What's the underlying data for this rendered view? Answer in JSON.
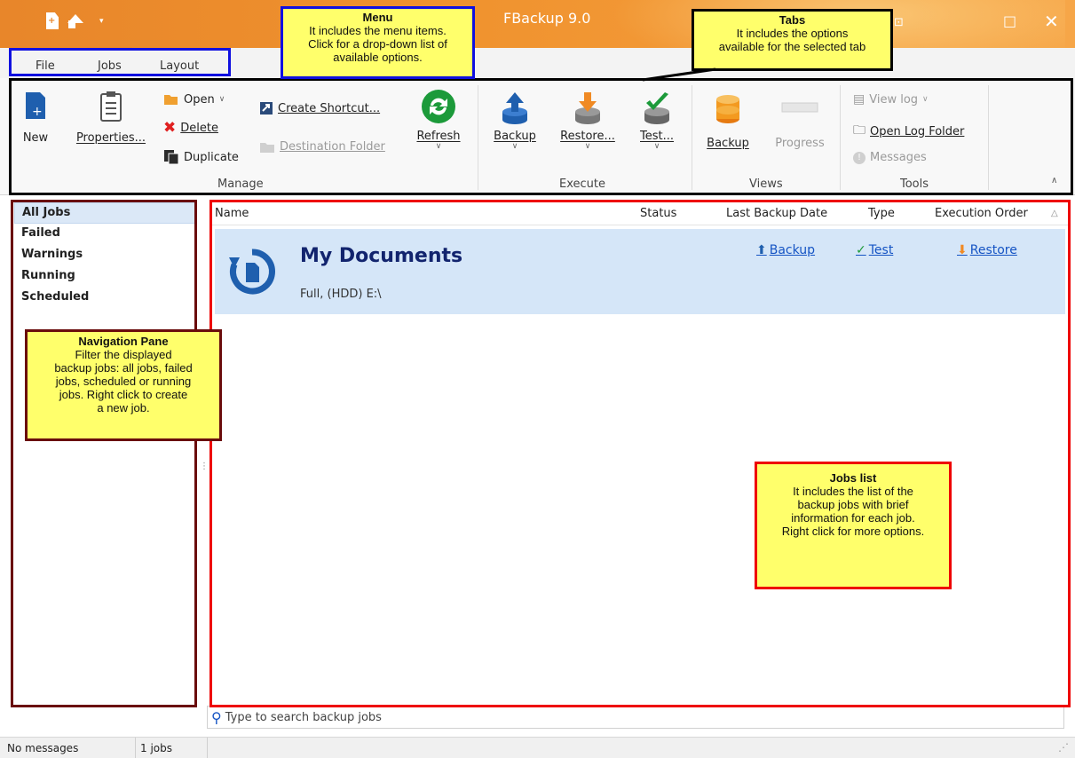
{
  "window": {
    "title": "FBackup 9.0"
  },
  "menu": {
    "file": "File",
    "jobs": "Jobs",
    "layout": "Layout"
  },
  "ribbon": {
    "manage": {
      "new": "New",
      "properties": "Properties...",
      "open": "Open",
      "delete": "Delete",
      "duplicate": "Duplicate",
      "create_shortcut": "Create Shortcut...",
      "destination_folder": "Destination Folder",
      "refresh": "Refresh",
      "group_label": "Manage"
    },
    "execute": {
      "backup": "Backup",
      "restore": "Restore...",
      "test": "Test...",
      "group_label": "Execute"
    },
    "views": {
      "backup": "Backup",
      "progress": "Progress",
      "group_label": "Views"
    },
    "tools": {
      "view_log": "View log",
      "open_log_folder": "Open Log Folder",
      "messages": "Messages",
      "group_label": "Tools"
    }
  },
  "nav": {
    "items": [
      "All Jobs",
      "Failed",
      "Warnings",
      "Running",
      "Scheduled"
    ]
  },
  "jobs_list": {
    "columns": {
      "name": "Name",
      "status": "Status",
      "last_backup_date": "Last Backup Date",
      "type": "Type",
      "execution_order": "Execution Order"
    },
    "rows": [
      {
        "name": "My Documents",
        "desc": "Full, (HDD) E:\\",
        "backup_link": "Backup",
        "test_link": "Test",
        "restore_link": "Restore"
      }
    ]
  },
  "search": {
    "placeholder": "Type to search backup jobs"
  },
  "status": {
    "messages": "No messages",
    "jobs": "1 jobs"
  },
  "annotations": {
    "menu": {
      "title": "Menu",
      "l1": "It includes the menu items.",
      "l2": "Click for a drop-down list of",
      "l3": "available options."
    },
    "tabs": {
      "title": "Tabs",
      "l1": "It includes the options",
      "l2": "available for the selected tab"
    },
    "nav": {
      "title": "Navigation Pane",
      "l1": "Filter the displayed",
      "l2": "backup jobs: all jobs, failed",
      "l3": "jobs, scheduled or running",
      "l4": "jobs. Right click to create",
      "l5": "a new job."
    },
    "jobs": {
      "title": "Jobs list",
      "l1": "It includes the list of the",
      "l2": "backup jobs with brief",
      "l3": "information for each job.",
      "l4": "Right click for more options."
    }
  },
  "colors": {
    "accent": "#e8862a",
    "blue_box": "#1010e0",
    "black_box": "#000000",
    "red_box": "#ee0000",
    "dark_red_box": "#6a0c0c",
    "callout": "#ffff6b"
  }
}
